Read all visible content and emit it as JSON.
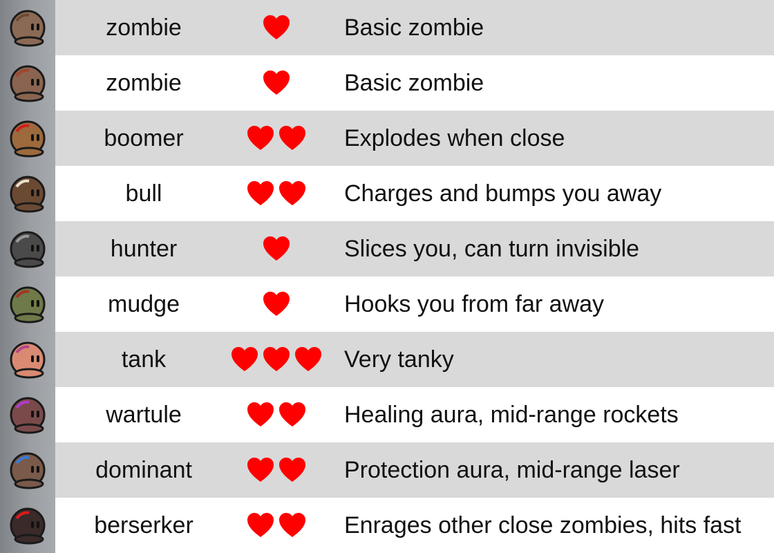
{
  "colors": {
    "heart": "#ff0000",
    "row_shade": "#d9d9d9",
    "row_plain": "#ffffff",
    "icon_column": "#9b9ea2",
    "text": "#111111"
  },
  "rows": [
    {
      "name": "zombie",
      "hearts": 1,
      "description": "Basic zombie",
      "skin": "#8a6a55",
      "accent": "#6b4a38",
      "icon": "zombie-icon"
    },
    {
      "name": "zombie",
      "hearts": 1,
      "description": "Basic zombie",
      "skin": "#8a6450",
      "accent": "#a0452e",
      "icon": "zombie-icon"
    },
    {
      "name": "boomer",
      "hearts": 2,
      "description": "Explodes when close",
      "skin": "#9c6a3c",
      "accent": "#d21e1e",
      "icon": "boomer-icon"
    },
    {
      "name": "bull",
      "hearts": 2,
      "description": "Charges and bumps you away",
      "skin": "#6b4a34",
      "accent": "#e8e2d0",
      "icon": "bull-icon"
    },
    {
      "name": "hunter",
      "hearts": 1,
      "description": "Slices you, can turn invisible",
      "skin": "#4a4a4a",
      "accent": "#9a9a9a",
      "icon": "hunter-icon"
    },
    {
      "name": "mudge",
      "hearts": 1,
      "description": "Hooks you from far away",
      "skin": "#6e7a48",
      "accent": "#a3342a",
      "icon": "mudge-icon"
    },
    {
      "name": "tank",
      "hearts": 3,
      "description": "Very tanky",
      "skin": "#d98a72",
      "accent": "#b2458a",
      "icon": "tank-icon"
    },
    {
      "name": "wartule",
      "hearts": 2,
      "description": "Healing aura, mid-range rockets",
      "skin": "#7a4a4a",
      "accent": "#b03cc8",
      "icon": "wartule-icon"
    },
    {
      "name": "dominant",
      "hearts": 2,
      "description": "Protection aura, mid-range laser",
      "skin": "#7a5a4a",
      "accent": "#3a7ad8",
      "icon": "dominant-icon"
    },
    {
      "name": "berserker",
      "hearts": 2,
      "description": "Enrages other close zombies, hits fast",
      "skin": "#3a2a2a",
      "accent": "#e01a1a",
      "icon": "berserker-icon"
    }
  ]
}
